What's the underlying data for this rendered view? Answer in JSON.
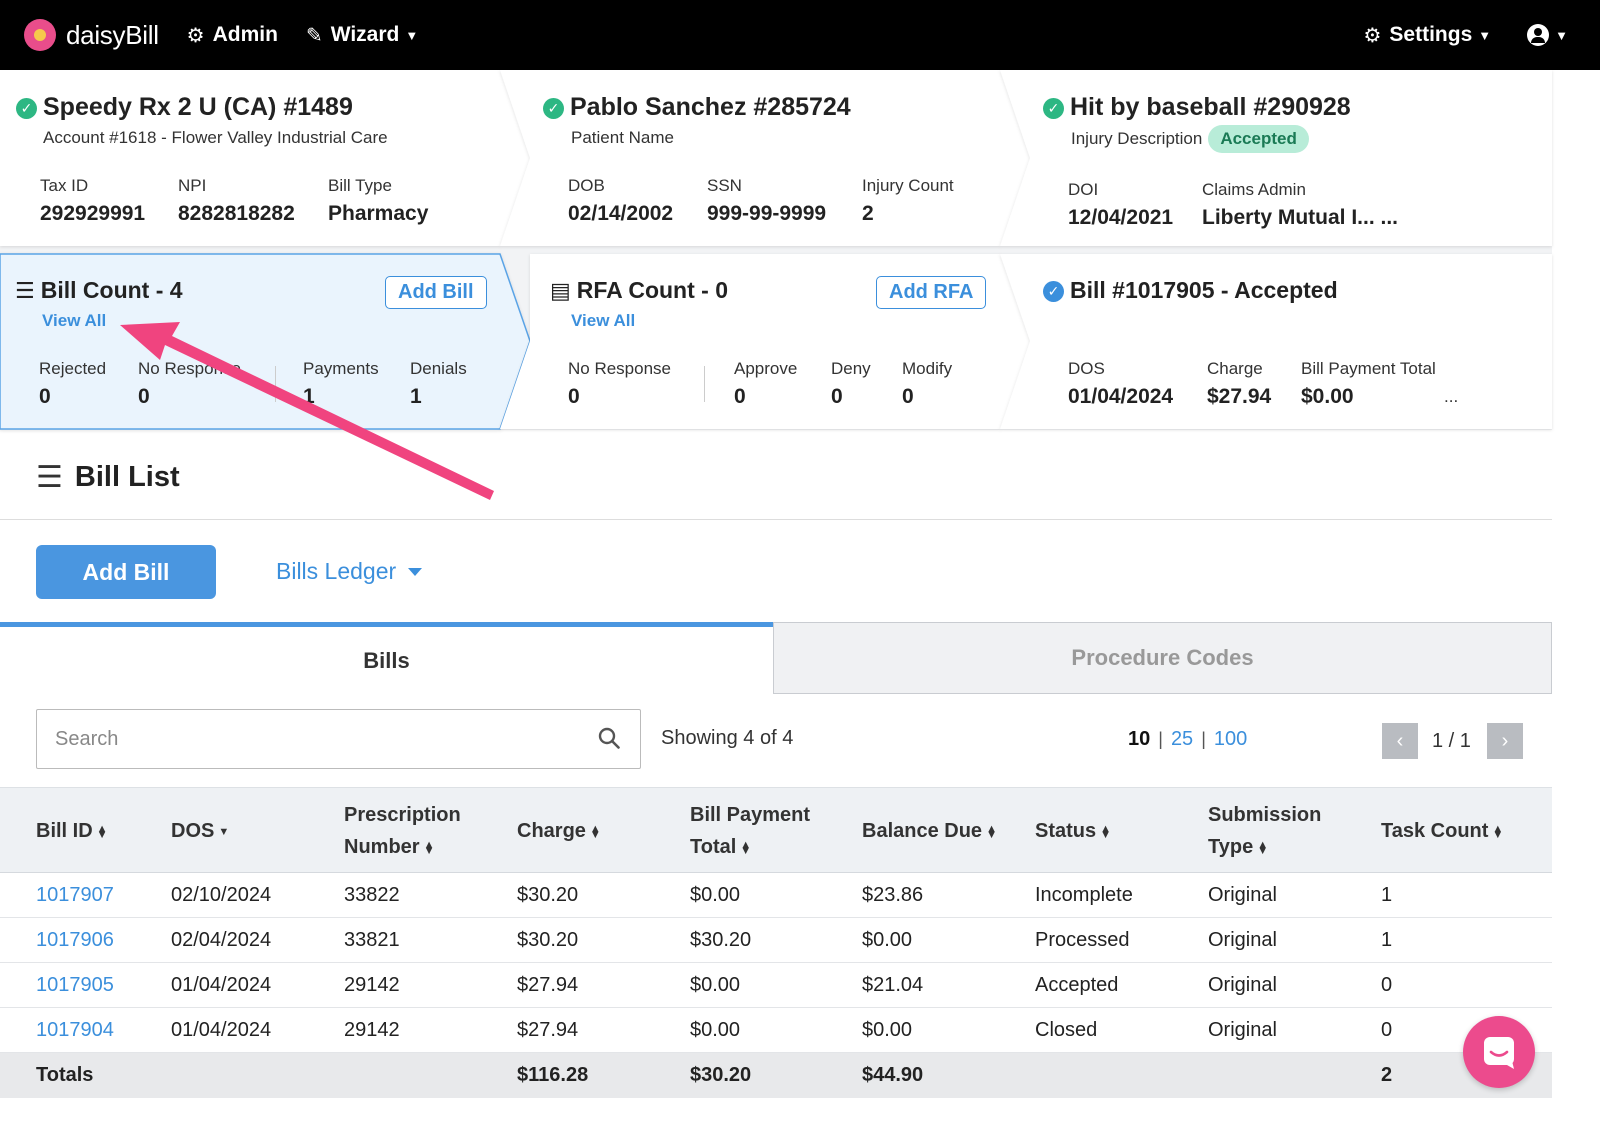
{
  "nav": {
    "brand": "daisyBill",
    "admin": "Admin",
    "wizard": "Wizard",
    "settings": "Settings"
  },
  "provider": {
    "title": "Speedy Rx 2 U (CA) #1489",
    "account": "Account #1618 - Flower Valley Industrial Care",
    "tax_id_label": "Tax ID",
    "tax_id": "292929991",
    "npi_label": "NPI",
    "npi": "8282818282",
    "bill_type_label": "Bill Type",
    "bill_type": "Pharmacy"
  },
  "patient": {
    "title": "Pablo Sanchez #285724",
    "subtitle": "Patient Name",
    "dob_label": "DOB",
    "dob": "02/14/2002",
    "ssn_label": "SSN",
    "ssn": "999-99-9999",
    "injury_count_label": "Injury Count",
    "injury_count": "2"
  },
  "injury": {
    "title": "Hit by baseball #290928",
    "subtitle": "Injury Description",
    "status": "Accepted",
    "doi_label": "DOI",
    "doi": "12/04/2021",
    "claims_admin_label": "Claims Admin",
    "claims_admin": "Liberty Mutual I... ..."
  },
  "bill_count": {
    "title": "Bill Count - 4",
    "add_button": "Add Bill",
    "view_all": "View All",
    "rejected_label": "Rejected",
    "rejected": "0",
    "no_response_label": "No Response",
    "no_response": "0",
    "payments_label": "Payments",
    "payments": "1",
    "denials_label": "Denials",
    "denials": "1"
  },
  "rfa_count": {
    "title": "RFA Count - 0",
    "add_button": "Add RFA",
    "view_all": "View All",
    "no_response_label": "No Response",
    "no_response": "0",
    "approve_label": "Approve",
    "approve": "0",
    "deny_label": "Deny",
    "deny": "0",
    "modify_label": "Modify",
    "modify": "0"
  },
  "bill_detail": {
    "title": "Bill #1017905 - Accepted",
    "dos_label": "DOS",
    "dos": "01/04/2024",
    "charge_label": "Charge",
    "charge": "$27.94",
    "payment_total_label": "Bill Payment Total",
    "payment_total": "$0.00",
    "more": "..."
  },
  "bill_list": {
    "title": "Bill List",
    "add_bill": "Add Bill",
    "ledger": "Bills Ledger",
    "tabs": [
      "Bills",
      "Procedure Codes"
    ],
    "search_placeholder": "Search",
    "showing": "Showing 4 of 4",
    "page_sizes": [
      "10",
      "25",
      "100"
    ],
    "page": "1 / 1"
  },
  "table": {
    "headers": {
      "bill_id": "Bill ID",
      "dos": "DOS",
      "rx_1": "Prescription",
      "rx_2": "Number",
      "charge": "Charge",
      "bpt_1": "Bill Payment",
      "bpt_2": "Total",
      "balance": "Balance Due",
      "status": "Status",
      "sub_1": "Submission",
      "sub_2": "Type",
      "tasks": "Task Count"
    },
    "rows": [
      {
        "bill_id": "1017907",
        "dos": "02/10/2024",
        "rx": "33822",
        "charge": "$30.20",
        "payment": "$0.00",
        "balance": "$23.86",
        "status": "Incomplete",
        "type": "Original",
        "tasks": "1"
      },
      {
        "bill_id": "1017906",
        "dos": "02/04/2024",
        "rx": "33821",
        "charge": "$30.20",
        "payment": "$30.20",
        "balance": "$0.00",
        "status": "Processed",
        "type": "Original",
        "tasks": "1"
      },
      {
        "bill_id": "1017905",
        "dos": "01/04/2024",
        "rx": "29142",
        "charge": "$27.94",
        "payment": "$0.00",
        "balance": "$21.04",
        "status": "Accepted",
        "type": "Original",
        "tasks": "0"
      },
      {
        "bill_id": "1017904",
        "dos": "01/04/2024",
        "rx": "29142",
        "charge": "$27.94",
        "payment": "$0.00",
        "balance": "$0.00",
        "status": "Closed",
        "type": "Original",
        "tasks": "0"
      }
    ],
    "totals": {
      "label": "Totals",
      "charge": "$116.28",
      "payment": "$30.20",
      "balance": "$44.90",
      "tasks": "2"
    }
  },
  "colors": {
    "accent": "#3b8fdc",
    "success": "#2db783",
    "annotation_arrow": "#f0447f",
    "chat": "#ec4b8d"
  }
}
